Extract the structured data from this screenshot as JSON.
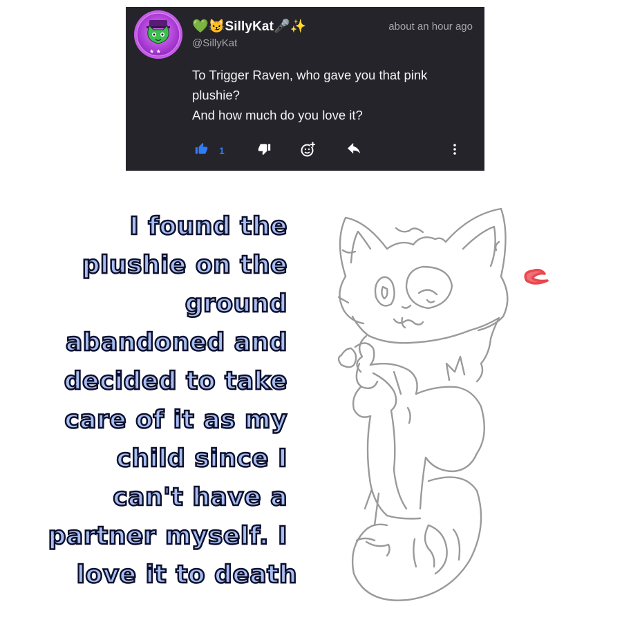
{
  "comment": {
    "username": "💚😼SillyKat🎤✨",
    "handle": "@SillyKat",
    "timestamp": "about an hour ago",
    "body_lines": [
      "To Trigger Raven, who gave you that pink",
      "plushie?",
      "And how much do you love it?"
    ],
    "like_count": "1",
    "colors": {
      "card_bg": "#25242a",
      "like_blue": "#2e7df6",
      "muted_text": "#a7a6ad",
      "avatar_purple": "#b042d8"
    },
    "icons": [
      "thumbs-up-icon",
      "thumbs-down-icon",
      "add-reaction-icon",
      "reply-icon",
      "more-options-icon"
    ]
  },
  "reply": {
    "lines": [
      "I found the",
      "plushie on the",
      "ground",
      "abandoned and",
      "decided to take",
      "care of it as my",
      "child since I",
      "can't have a",
      "partner myself. I",
      "love it to death"
    ],
    "text_color": "#a9bff0",
    "outline_color": "#0c0f2e"
  },
  "drawing": {
    "subject": "cat-character-sketch-holding-plushie",
    "heart_color": "#e8484f"
  }
}
